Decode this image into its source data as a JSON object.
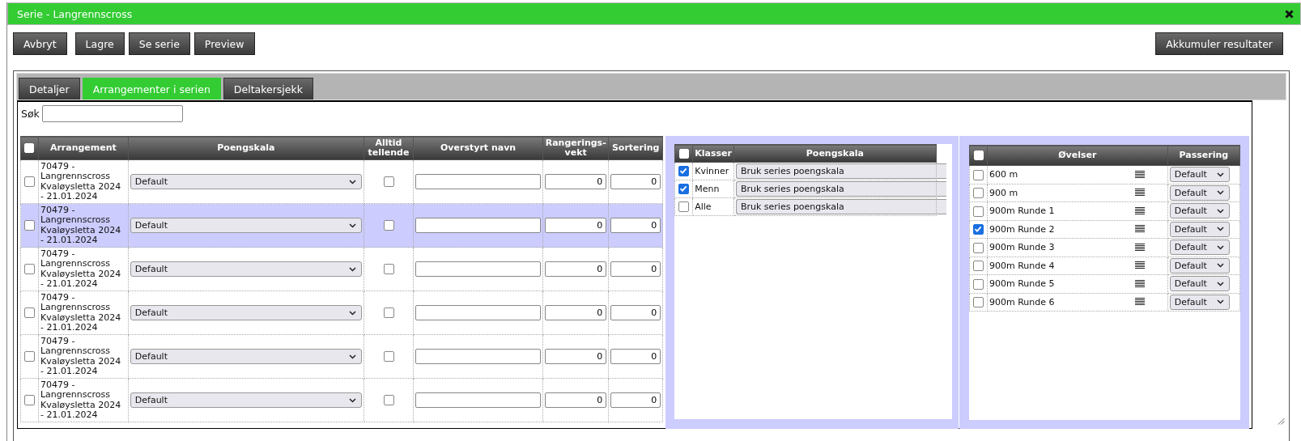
{
  "window": {
    "title": "Serie - Langrennscross"
  },
  "toolbar": {
    "buttons": [
      "Avbryt",
      "Lagre",
      "Se serie",
      "Preview"
    ],
    "right_button": "Akkumuler resultater"
  },
  "tabs": [
    {
      "label": "Detaljer",
      "selected": false
    },
    {
      "label": "Arrangementer i serien",
      "selected": true
    },
    {
      "label": "Deltakersjekk",
      "selected": false
    }
  ],
  "search": {
    "label": "Søk"
  },
  "events_table": {
    "select_all_checked": false,
    "columns": [
      "Arrangement",
      "Poengskala",
      "Alltid tellende",
      "Overstyrt navn",
      "Rangerings-vekt",
      "Sortering"
    ],
    "rows": [
      {
        "checked": false,
        "selected": false,
        "event": "70479 - Langrennscross Kvaløysletta 2024 - 21.01.2024",
        "scale": "Default",
        "always_counting": false,
        "weight": "0",
        "sort": "0"
      },
      {
        "checked": false,
        "selected": true,
        "event": "70479 - Langrennscross Kvaløysletta 2024 - 21.01.2024",
        "scale": "Default",
        "always_counting": false,
        "weight": "0",
        "sort": "0"
      },
      {
        "checked": false,
        "selected": false,
        "event": "70479 - Langrennscross Kvaløysletta 2024 - 21.01.2024",
        "scale": "Default",
        "always_counting": false,
        "weight": "0",
        "sort": "0"
      },
      {
        "checked": false,
        "selected": false,
        "event": "70479 - Langrennscross Kvaløysletta 2024 - 21.01.2024",
        "scale": "Default",
        "always_counting": false,
        "weight": "0",
        "sort": "0"
      },
      {
        "checked": false,
        "selected": false,
        "event": "70479 - Langrennscross Kvaløysletta 2024 - 21.01.2024",
        "scale": "Default",
        "always_counting": false,
        "weight": "0",
        "sort": "0"
      },
      {
        "checked": false,
        "selected": false,
        "event": "70479 - Langrennscross Kvaløysletta 2024 - 21.01.2024",
        "scale": "Default",
        "always_counting": false,
        "weight": "0",
        "sort": "0"
      }
    ]
  },
  "classes_table": {
    "select_all_checked": false,
    "columns": [
      "Klasser",
      "Poengskala"
    ],
    "rows": [
      {
        "checked": true,
        "name": "Kvinner",
        "scale": "Bruk series poengskala"
      },
      {
        "checked": true,
        "name": "Menn",
        "scale": "Bruk series poengskala"
      },
      {
        "checked": false,
        "name": "Alle",
        "scale": "Bruk series poengskala"
      }
    ]
  },
  "exercises_table": {
    "select_all_checked": false,
    "columns": [
      "Øvelser",
      "Passering"
    ],
    "rows": [
      {
        "checked": false,
        "name": "600 m",
        "passing": "Default"
      },
      {
        "checked": false,
        "name": "900 m",
        "passing": "Default"
      },
      {
        "checked": false,
        "name": "900m Runde 1",
        "passing": "Default"
      },
      {
        "checked": true,
        "name": "900m Runde 2",
        "passing": "Default"
      },
      {
        "checked": false,
        "name": "900m Runde 3",
        "passing": "Default"
      },
      {
        "checked": false,
        "name": "900m Runde 4",
        "passing": "Default"
      },
      {
        "checked": false,
        "name": "900m Runde 5",
        "passing": "Default"
      },
      {
        "checked": false,
        "name": "900m Runde 6",
        "passing": "Default"
      }
    ]
  }
}
